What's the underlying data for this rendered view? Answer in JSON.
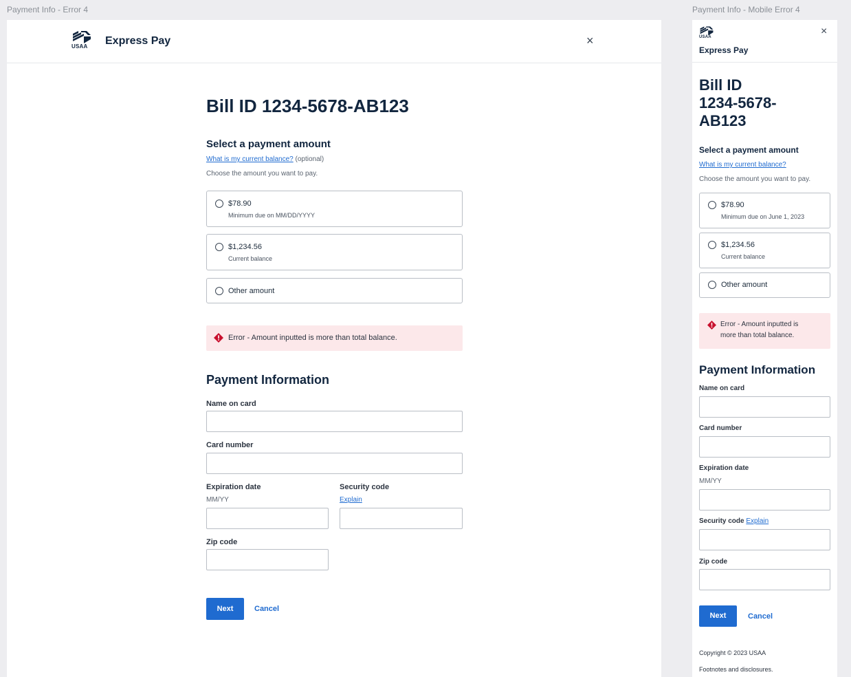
{
  "frames": {
    "desktop_label": "Payment Info - Error 4",
    "mobile_label": "Payment Info - Mobile Error 4"
  },
  "header": {
    "logo_text": "USAA",
    "brand": "Express Pay",
    "close_glyph": "×"
  },
  "bill": {
    "title": "Bill ID 1234-5678-AB123",
    "mobile_title_lines": [
      "Bill ID",
      "1234-5678-",
      "AB123"
    ]
  },
  "amount": {
    "heading": "Select a payment amount",
    "balance_link": "What is my current balance?",
    "optional": "(optional)",
    "instruction": "Choose the amount you want to pay.",
    "options": [
      {
        "label": "$78.90",
        "desktop_sub": "Minimum due on MM/DD/YYYY",
        "mobile_sub": "Minimum due on June 1, 2023"
      },
      {
        "label": "$1,234.56",
        "desktop_sub": "Current balance",
        "mobile_sub": "Current balance"
      },
      {
        "label": "Other amount"
      }
    ]
  },
  "error": {
    "message": "Error - Amount inputted is more than total balance.",
    "mobile_line1": "Error - Amount inputted is",
    "mobile_line2": "more than total balance.",
    "icon": "error-diamond-icon",
    "color": "#c8102e",
    "background": "#fce8ea"
  },
  "payment": {
    "heading": "Payment Information",
    "name_label": "Name on card",
    "card_label": "Card number",
    "exp_label": "Expiration date",
    "exp_hint": "MM/YY",
    "sec_label": "Security code",
    "sec_link": "Explain",
    "zip_label": "Zip code"
  },
  "actions": {
    "next": "Next",
    "cancel": "Cancel"
  },
  "footer": {
    "copyright": "Copyright © 2023 USAA",
    "footnotes": "Footnotes and disclosures."
  },
  "colors": {
    "accent": "#1f6bd0",
    "heading": "#12263f"
  }
}
